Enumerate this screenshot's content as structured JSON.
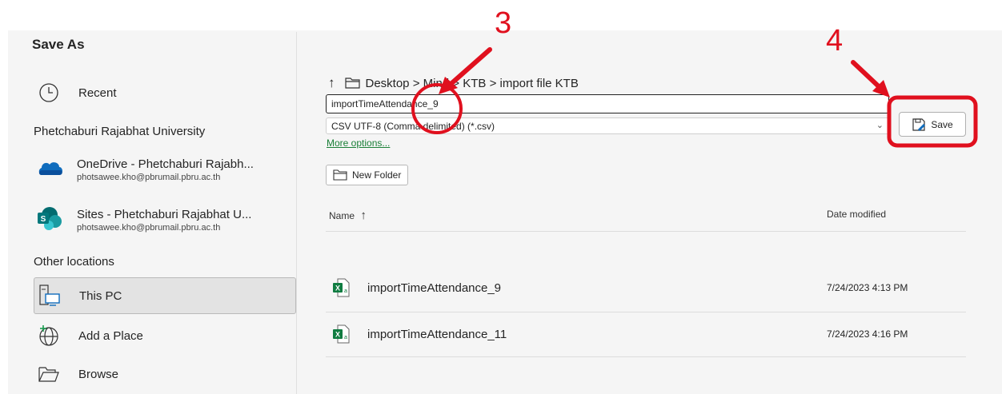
{
  "dialog": {
    "title": "Save As"
  },
  "sidebar": {
    "recent": "Recent",
    "org": "Phetchaburi Rajabhat University",
    "onedrive": {
      "name": "OneDrive - Phetchaburi Rajabh...",
      "email": "photsawee.kho@pbrumail.pbru.ac.th"
    },
    "sites": {
      "name": "Sites - Phetchaburi Rajabhat U...",
      "email": "photsawee.kho@pbrumail.pbru.ac.th"
    },
    "other_locations": "Other locations",
    "this_pc": "This PC",
    "add_place": "Add a Place",
    "browse": "Browse"
  },
  "breadcrumb": {
    "arrow": "↑",
    "path": "Desktop > Mind > KTB > import file KTB"
  },
  "filename": {
    "value": "importTimeAttendance_9"
  },
  "filetype": {
    "value": "CSV UTF-8 (Comma delimited) (*.csv)"
  },
  "more_options": "More options...",
  "save_label": "Save",
  "new_folder_label": "New Folder",
  "columns": {
    "name": "Name",
    "sort_arrow": "↑",
    "date": "Date modified"
  },
  "files": [
    {
      "name": "importTimeAttendance_9",
      "date": "7/24/2023 4:13 PM"
    },
    {
      "name": "importTimeAttendance_11",
      "date": "7/24/2023 4:16 PM"
    }
  ],
  "annotations": {
    "step3": "3",
    "step4": "4",
    "color": "#e0101e"
  }
}
